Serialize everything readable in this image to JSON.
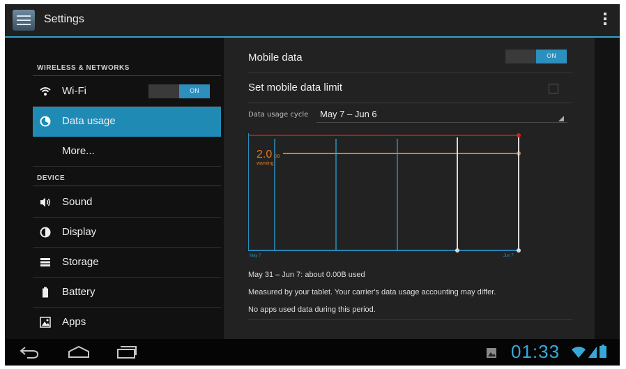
{
  "actionbar": {
    "title": "Settings",
    "icon": "settings-app-icon",
    "overflow_icon": "overflow-menu-icon"
  },
  "sidebar": {
    "section_wireless": "WIRELESS & NETWORKS",
    "section_device": "DEVICE",
    "items": [
      {
        "label": "Wi-Fi",
        "icon": "wifi-icon",
        "toggle": "ON"
      },
      {
        "label": "Data usage",
        "icon": "data-usage-icon",
        "selected": true
      },
      {
        "label": "More..."
      },
      {
        "label": "Sound",
        "icon": "speaker-icon"
      },
      {
        "label": "Display",
        "icon": "brightness-icon"
      },
      {
        "label": "Storage",
        "icon": "storage-icon"
      },
      {
        "label": "Battery",
        "icon": "battery-icon"
      },
      {
        "label": "Apps",
        "icon": "apps-icon"
      }
    ]
  },
  "main": {
    "mobile_data_label": "Mobile data",
    "mobile_data_toggle": "ON",
    "data_limit_label": "Set mobile data limit",
    "data_limit_checked": false,
    "cycle_label": "Data usage cycle",
    "cycle_value": "May 7 – Jun 6",
    "chart": {
      "warning_value": "2.0",
      "warning_unit": "GB",
      "warning_label": "warning",
      "start_label": "May 7",
      "end_label": "Jun 7"
    },
    "usage_text": "May 31 – Jun 7: about 0.00B used",
    "carrier_note": "Measured by your tablet. Your carrier's data usage accounting may differ.",
    "no_apps_text": "No apps used data during this period."
  },
  "colors": {
    "accent": "#33a3cc",
    "limit_line": "#d02020",
    "warning_line": "#e07a1a"
  },
  "navbar": {
    "back_icon": "back-icon",
    "home_icon": "home-icon",
    "recents_icon": "recent-apps-icon",
    "gallery_icon": "gallery-notification-icon",
    "clock": "01:33",
    "wifi_icon": "wifi-status-icon",
    "signal_icon": "signal-icon",
    "battery_icon": "battery-status-icon"
  }
}
